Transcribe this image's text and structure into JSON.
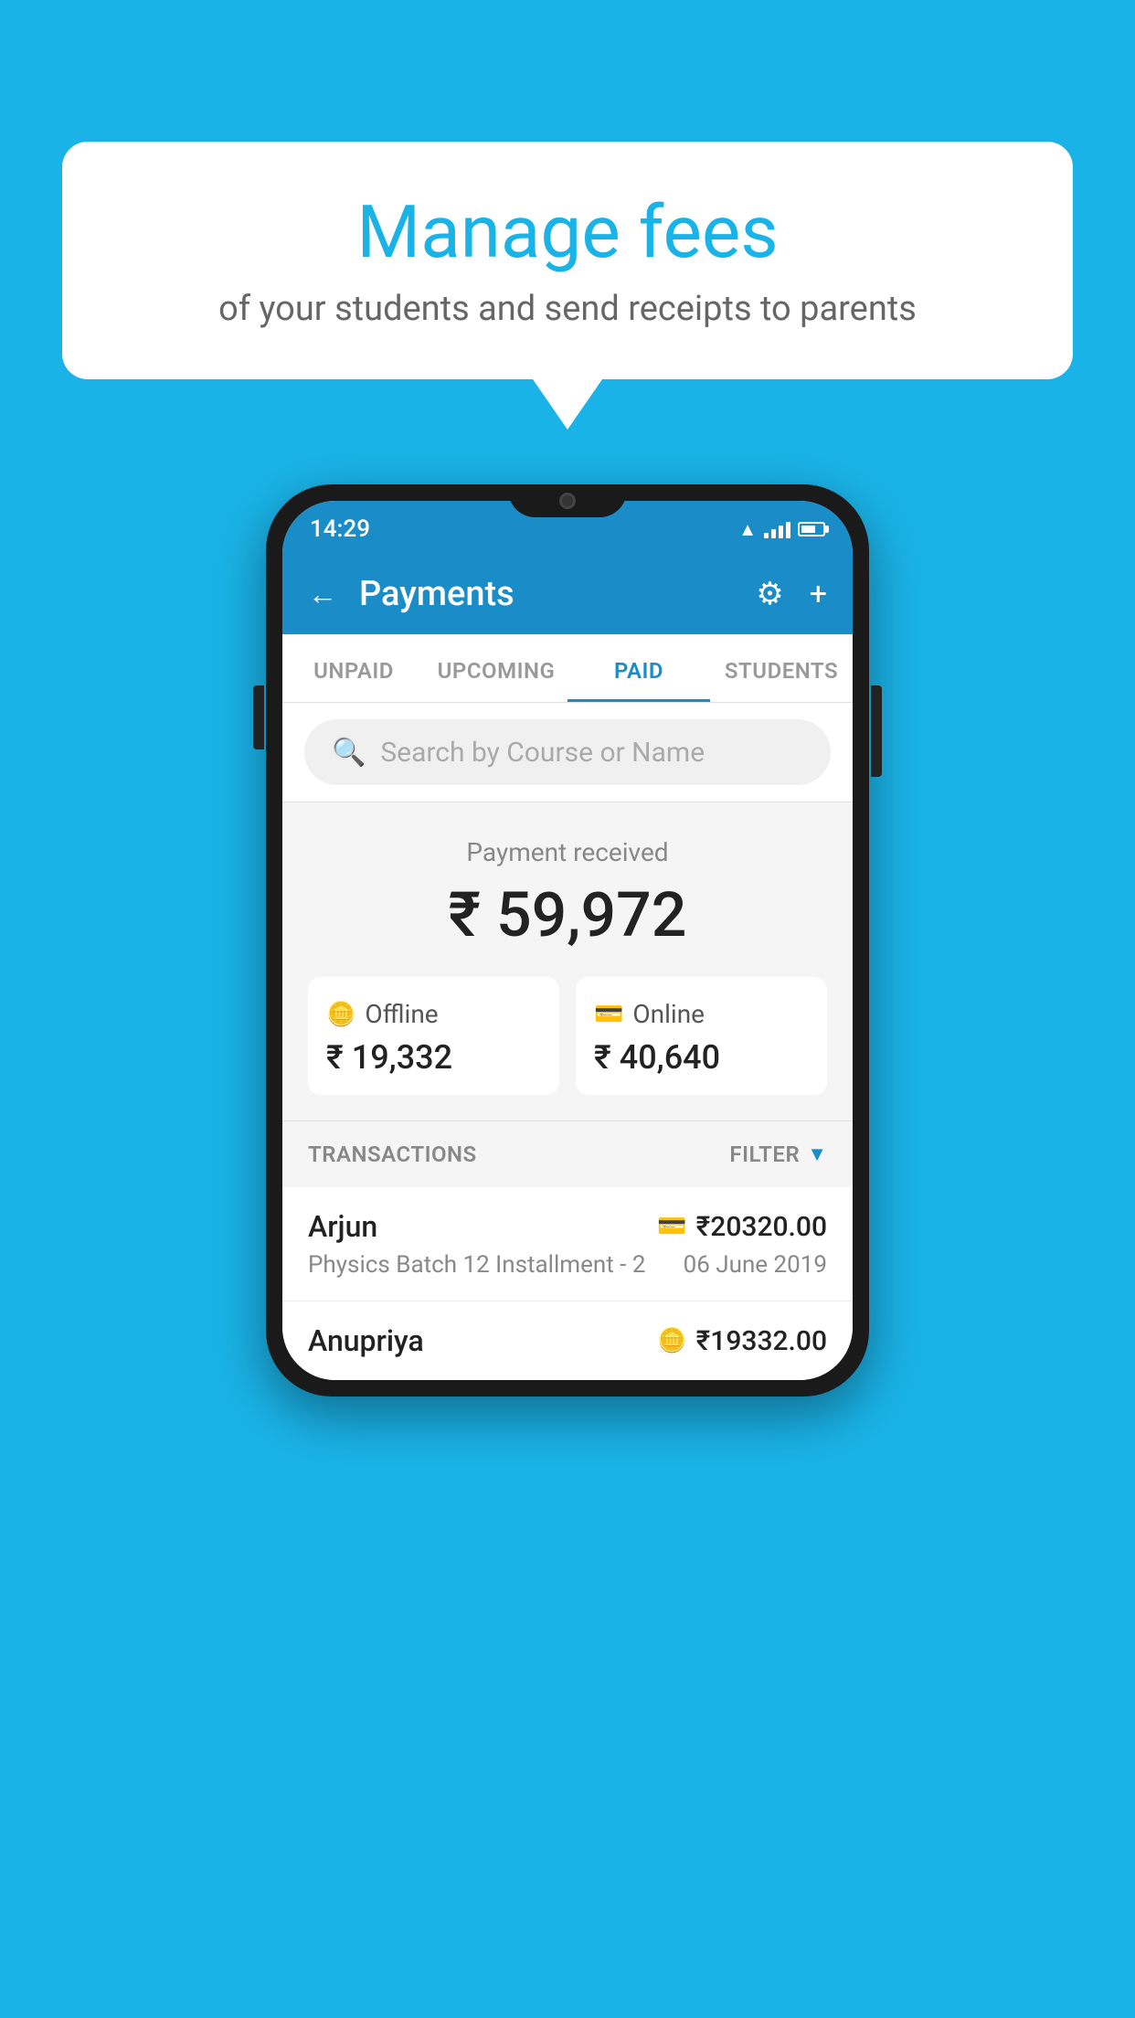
{
  "background_color": "#1ab3e8",
  "speech_bubble": {
    "title": "Manage fees",
    "subtitle": "of your students and send receipts to parents"
  },
  "status_bar": {
    "time": "14:29"
  },
  "app_header": {
    "title": "Payments",
    "back_label": "←",
    "plus_label": "+"
  },
  "tabs": [
    {
      "label": "UNPAID",
      "active": false
    },
    {
      "label": "UPCOMING",
      "active": false
    },
    {
      "label": "PAID",
      "active": true
    },
    {
      "label": "STUDENTS",
      "active": false
    }
  ],
  "search": {
    "placeholder": "Search by Course or Name"
  },
  "payment_received": {
    "label": "Payment received",
    "amount": "₹ 59,972",
    "offline": {
      "type": "Offline",
      "amount": "₹ 19,332"
    },
    "online": {
      "type": "Online",
      "amount": "₹ 40,640"
    }
  },
  "transactions": {
    "header_label": "TRANSACTIONS",
    "filter_label": "FILTER",
    "rows": [
      {
        "name": "Arjun",
        "amount": "₹20320.00",
        "course": "Physics Batch 12 Installment - 2",
        "date": "06 June 2019",
        "pay_type": "card"
      },
      {
        "name": "Anupriya",
        "amount": "₹19332.00",
        "course": "",
        "date": "",
        "pay_type": "cash"
      }
    ]
  }
}
